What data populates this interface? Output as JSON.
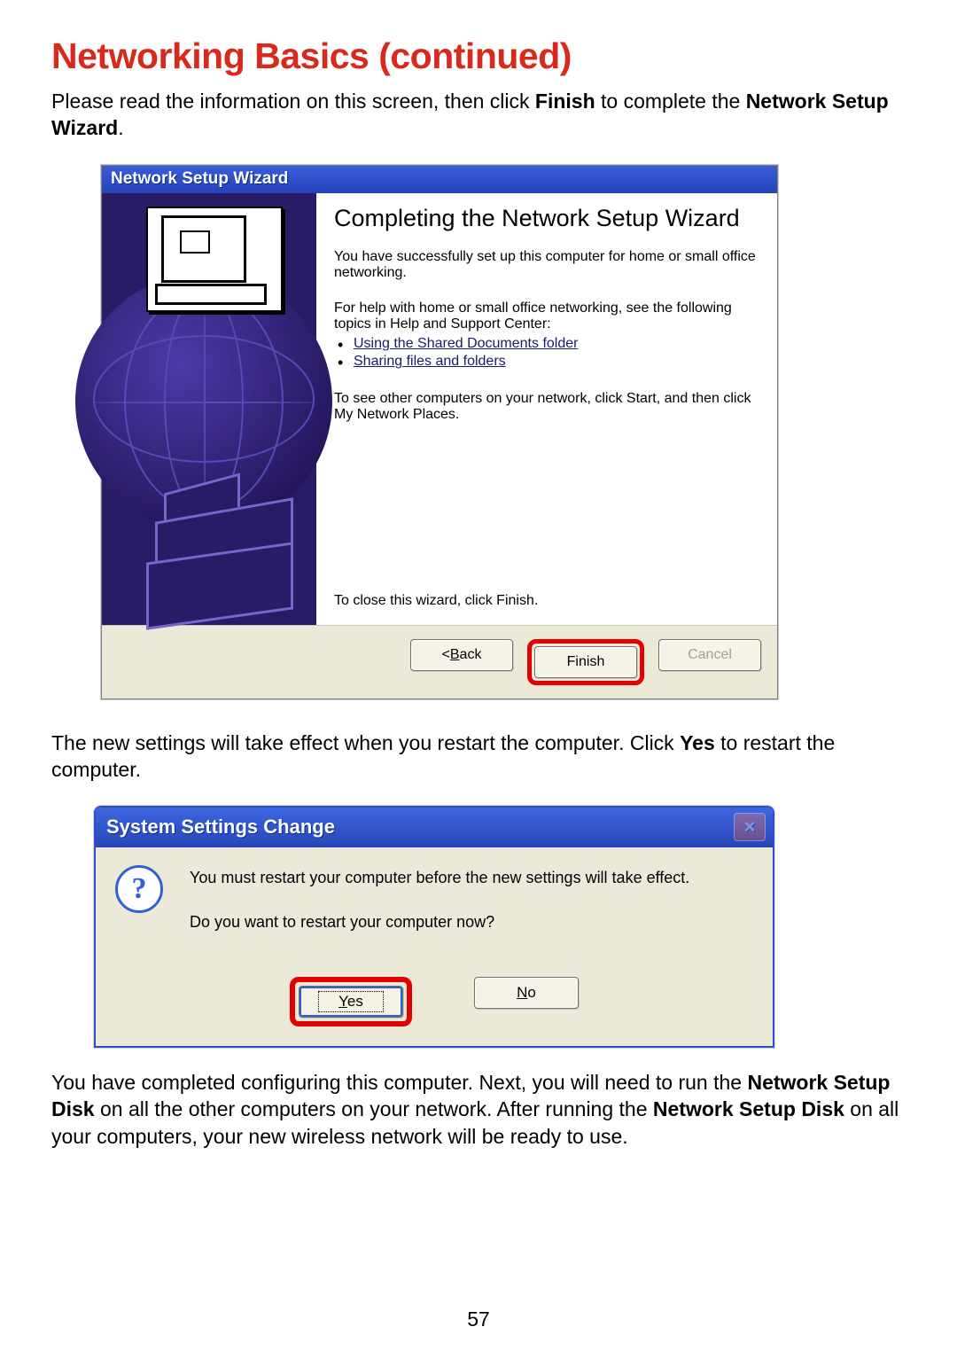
{
  "page": {
    "heading": "Networking Basics (continued)",
    "para1_a": "Please read the information on this screen, then click ",
    "para1_b": "Finish",
    "para1_c": " to complete the ",
    "para1_d": "Network Setup Wizard",
    "para1_e": ".",
    "para2_a": "The new settings will take effect when you restart the computer.  Click ",
    "para2_b": "Yes",
    "para2_c": " to restart the computer.",
    "para3_a": "You have completed configuring this computer.  Next, you will need to run the ",
    "para3_b": "Network Setup Disk",
    "para3_c": " on all the other computers on your network.  After running the ",
    "para3_d": "Network Setup Disk",
    "para3_e": " on all your computers, your new wireless network will be ready to use.",
    "pagenum": "57"
  },
  "wizard": {
    "titlebar": "Network Setup Wizard",
    "title": "Completing the Network Setup Wizard",
    "p1": "You have successfully set up this computer for home or small office networking.",
    "p2": "For help with home or small office networking, see the following topics in Help and Support Center:",
    "link1": "Using the Shared Documents folder",
    "link2": "Sharing files and folders",
    "p3": "To see other computers on your network, click Start, and then click My Network Places.",
    "close": "To close this wizard, click Finish.",
    "buttons": {
      "back_pre": "< ",
      "back_u": "B",
      "back_post": "ack",
      "finish": "Finish",
      "cancel": "Cancel"
    }
  },
  "restart": {
    "titlebar": "System Settings Change",
    "line1": "You must restart your computer before the new settings will take effect.",
    "line2": "Do you want to restart your computer now?",
    "buttons": {
      "yes_u": "Y",
      "yes_post": "es",
      "no_u": "N",
      "no_post": "o"
    }
  }
}
